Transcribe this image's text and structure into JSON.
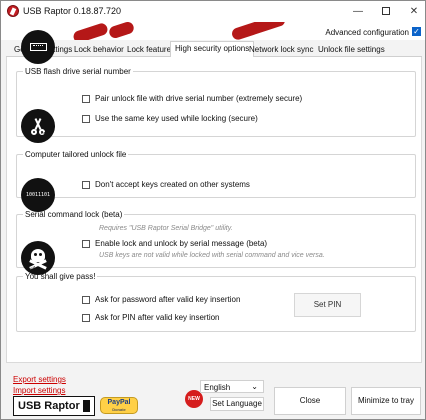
{
  "window": {
    "title": "USB Raptor 0.18.87.720",
    "controls": {
      "minimize": "—",
      "maximize": "",
      "close": "✕"
    }
  },
  "header": {
    "advanced_config_label": "Advanced configuration",
    "advanced_config_checked": true,
    "checkmark": "✓"
  },
  "tabs": [
    "General settings",
    "Lock behavior",
    "Lock features",
    "High security options",
    "Network lock sync",
    "Unlock file settings"
  ],
  "active_tab": "High security options",
  "groups": {
    "serial": {
      "title": "USB flash drive serial number",
      "options": [
        "Pair unlock file with drive serial number (extremely secure)",
        "Use the same key used while locking (secure)"
      ]
    },
    "computer": {
      "title": "Computer tailored unlock file",
      "option": "Don't accept keys created on other systems"
    },
    "serial_command": {
      "title": "Serial command lock (beta)",
      "hint1": "Requires \"USB Raptor Serial Bridge\" utility.",
      "option": "Enable lock and unlock by serial message (beta)",
      "hint2": "USB keys are not valid while locked with serial command and vice versa.",
      "icon_text": "10011101"
    },
    "pass": {
      "title": "You shall give pass!",
      "options": [
        "Ask for password after valid key insertion",
        "Ask for PIN after valid key insertion"
      ],
      "set_pin": "Set PIN"
    }
  },
  "footer": {
    "export": "Export settings",
    "import": "Import settings",
    "logo": "USB Raptor",
    "donate": "PayPal",
    "donate_small": "Donate",
    "new_badge": "NEW",
    "language": "English",
    "set_language": "Set Language",
    "close": "Close",
    "minimize_tray": "Minimize to tray"
  }
}
